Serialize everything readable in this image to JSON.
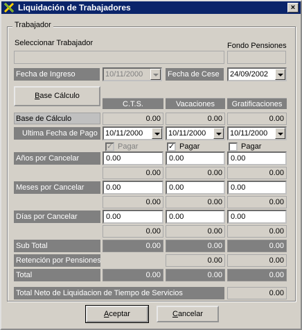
{
  "window": {
    "title": "Liquidación de Trabajadores",
    "close": "×"
  },
  "group": {
    "title": "Trabajador"
  },
  "worker": {
    "select_label": "Seleccionar Trabajador",
    "select_value": "",
    "fondo_label": "Fondo Pensiones",
    "fondo_value": ""
  },
  "dates": {
    "ingreso_label": "Fecha de Ingreso",
    "ingreso_value": "10/11/2000",
    "cese_label": "Fecha de Cese",
    "cese_value": "24/09/2002"
  },
  "base_button": {
    "label_pre": "",
    "label_ul": "B",
    "label_post": "ase Cálculo"
  },
  "columns": [
    "C.T.S.",
    "Vacaciones",
    "Gratificaciones"
  ],
  "rows": {
    "base_calculo": {
      "label": "Base de Cálculo",
      "values": [
        "0.00",
        "0.00",
        "0.00"
      ]
    },
    "ultima_fecha": {
      "label": "Ultima Fecha de Pago",
      "values": [
        "10/11/2000",
        "10/11/2000",
        "10/11/2000"
      ]
    },
    "pagar": {
      "label": "Pagar",
      "checked": [
        true,
        true,
        false
      ],
      "disabled": [
        true,
        false,
        false
      ]
    },
    "anos": {
      "label": "Años por Cancelar",
      "inputs": [
        "0.00",
        "0.00",
        "0.00"
      ],
      "results": [
        "0.00",
        "0.00",
        "0.00"
      ]
    },
    "meses": {
      "label": "Meses por Cancelar",
      "inputs": [
        "0.00",
        "0.00",
        "0.00"
      ],
      "results": [
        "0.00",
        "0.00",
        "0.00"
      ]
    },
    "dias": {
      "label": "Días por Cancelar",
      "inputs": [
        "0.00",
        "0.00",
        "0.00"
      ],
      "results": [
        "0.00",
        "0.00",
        "0.00"
      ]
    },
    "subtotal": {
      "label": "Sub Total",
      "values": [
        "0.00",
        "0.00",
        "0.00"
      ]
    },
    "retencion": {
      "label": "Retención por Pensiones",
      "values": [
        "",
        "0.00",
        "0.00"
      ]
    },
    "total": {
      "label": "Total",
      "values": [
        "0.00",
        "0.00",
        "0.00"
      ]
    }
  },
  "neto": {
    "label": "Total Neto de Liquidacion de Tiempo de Servicios",
    "value": "0.00"
  },
  "buttons": {
    "aceptar": {
      "ul": "A",
      "rest": "ceptar"
    },
    "cancelar": {
      "ul": "C",
      "rest": "ancelar"
    }
  },
  "colors": {
    "title_bar": "#0a246a",
    "face": "#d4d0c8",
    "dark_label": "#808080"
  },
  "icons": {
    "app": "app-logo-icon",
    "close": "close-icon",
    "dropdown": "chevron-down-icon",
    "check": "checkmark-icon"
  }
}
